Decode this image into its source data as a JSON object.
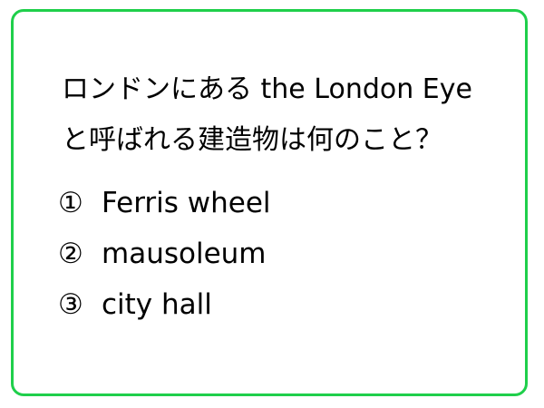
{
  "quiz": {
    "question_lines": [
      "ロンドンにある the London Eye",
      "と呼ばれる建造物は何のこと？"
    ],
    "options": [
      {
        "number": "①",
        "text": "Ferris wheel"
      },
      {
        "number": "②",
        "text": "mausoleum"
      },
      {
        "number": "③",
        "text": "city hall"
      }
    ]
  },
  "colors": {
    "border": "#1fcf4b",
    "text": "#000000",
    "background": "#ffffff"
  }
}
